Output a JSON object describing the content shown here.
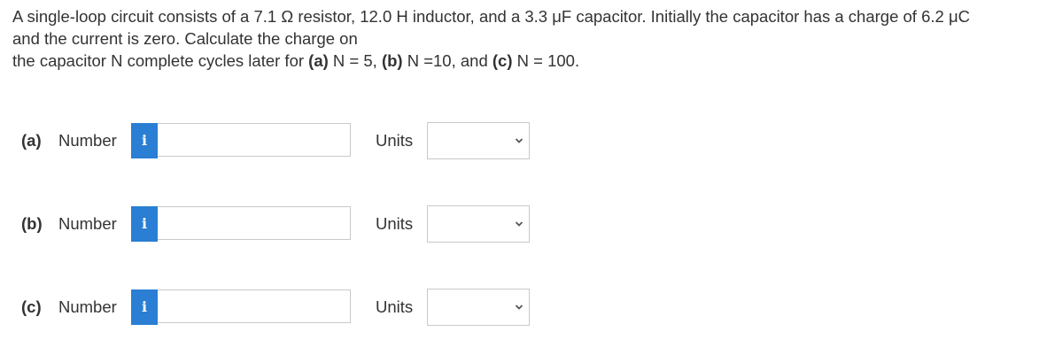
{
  "question": {
    "line1": "A single-loop circuit consists of a 7.1 Ω resistor, 12.0 H inductor, and a 3.3 μF capacitor. Initially the capacitor has a charge of 6.2 μC",
    "line2": "and the current is zero. Calculate the charge on",
    "line3_pre": "the capacitor N complete cycles later for ",
    "part_a_tag": "(a)",
    "part_a_text": " N = 5, ",
    "part_b_tag": "(b)",
    "part_b_text": " N =10, and ",
    "part_c_tag": "(c)",
    "part_c_text": " N = 100."
  },
  "rows": [
    {
      "part_label": "(a)",
      "number_label": "Number",
      "info_icon": "i",
      "number_value": "",
      "units_label": "Units",
      "units_selected": ""
    },
    {
      "part_label": "(b)",
      "number_label": "Number",
      "info_icon": "i",
      "number_value": "",
      "units_label": "Units",
      "units_selected": ""
    },
    {
      "part_label": "(c)",
      "number_label": "Number",
      "info_icon": "i",
      "number_value": "",
      "units_label": "Units",
      "units_selected": ""
    }
  ],
  "colors": {
    "info_button": "#2a7ed3",
    "text": "#333333",
    "border": "#c9c9c9"
  }
}
